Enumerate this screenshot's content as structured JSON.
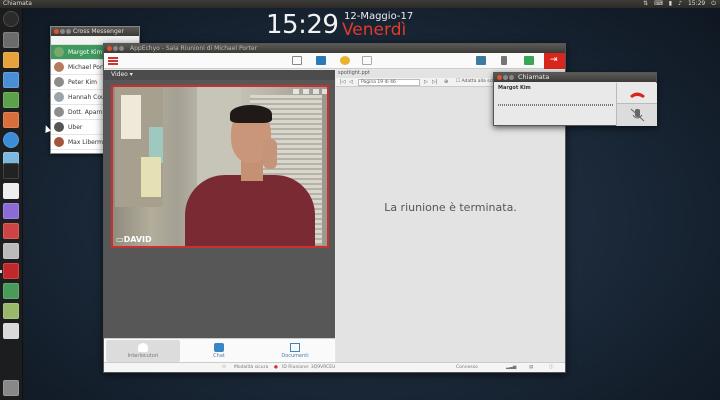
{
  "topbar": {
    "title": "Chiamata",
    "time": "15:29"
  },
  "desktop": {
    "clock": "15:29",
    "date": "12-Maggio-17",
    "day": "Venerdì"
  },
  "messenger": {
    "title": "Cross Messenger",
    "contacts": [
      {
        "name": "Margot Kim",
        "color": "#7aa86a"
      },
      {
        "name": "Michael Porter",
        "color": "#b67b5d"
      },
      {
        "name": "Peter Kim",
        "color": "#8c8c8c"
      },
      {
        "name": "Hannah Cousins",
        "color": "#9aa4ad"
      },
      {
        "name": "Dott. Aparna Shah",
        "color": "#8d8d8d"
      },
      {
        "name": "Uber",
        "color": "#555555"
      },
      {
        "name": "Max Liberman",
        "color": "#a4553c"
      }
    ]
  },
  "app": {
    "title": "AppEchyo - Sala Riunioni di Michael Porter",
    "video_label": "Video",
    "participant": "DAVID",
    "nav": [
      {
        "label": "Interlocutori"
      },
      {
        "label": "Chat"
      },
      {
        "label": "Documenti"
      }
    ],
    "doc_tab": "spotlight.ppt",
    "page_select": "Pagina 19 di 46",
    "fit_label": "Adatta alla schermata",
    "ended": "La riunione è terminata.",
    "status": {
      "left": "Modalità sicura",
      "id": "ID Riunione: 3Q9VRCEU",
      "connection": "Connesso"
    }
  },
  "call": {
    "title": "Chiamata",
    "name": "Margot Kim"
  },
  "colors": {
    "accent_red": "#d9261c",
    "selected_green": "#3f9a5f",
    "day_red": "#e33a2b"
  }
}
